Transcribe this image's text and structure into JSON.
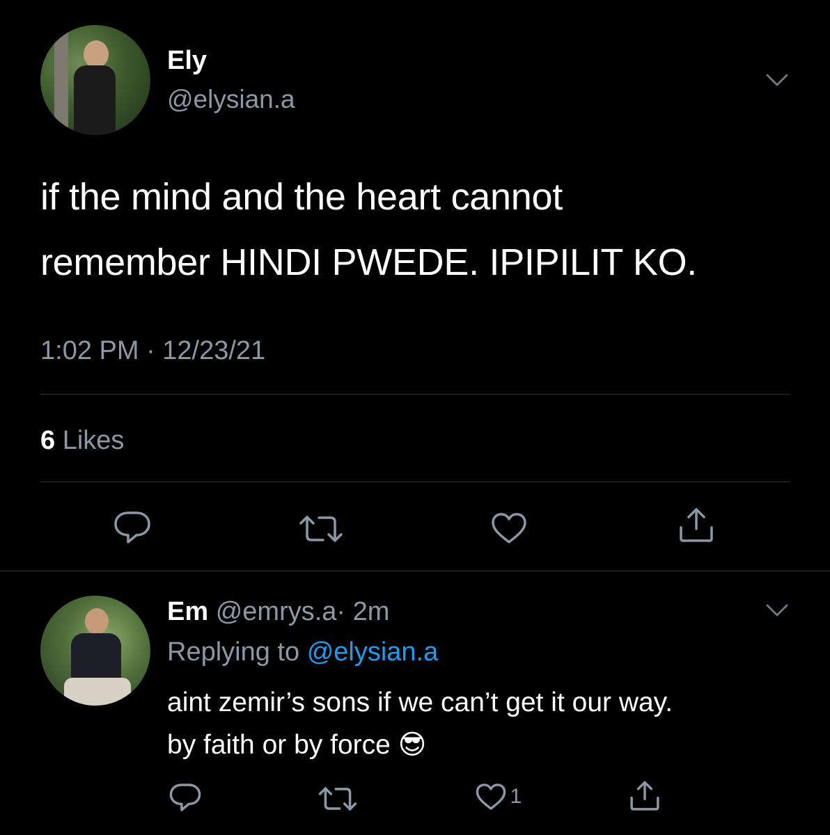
{
  "main_tweet": {
    "author_name": "Ely",
    "author_handle": "@elysian.a",
    "text_line1": "if the mind and the heart cannot",
    "text_line2": "remember HINDI PWEDE. IPIPILIT KO.",
    "timestamp": "1:02 PM · 12/23/21",
    "likes_count": "6",
    "likes_label": "Likes"
  },
  "reply": {
    "author_name": "Em",
    "author_handle": "@emrys.a",
    "age": "· 2m",
    "replying_prefix": "Replying to",
    "replying_to": "@elysian.a",
    "text_line1": "aint zemir’s sons if we can’t get it our way.",
    "text_line2": "by faith or by force",
    "emoji": "😎",
    "like_count": "1"
  },
  "icons": [
    "chevron-down-icon",
    "reply-icon",
    "retweet-icon",
    "heart-icon",
    "share-icon"
  ],
  "colors": {
    "background": "#000000",
    "text": "#ffffff",
    "secondary": "#8b98a5",
    "link": "#1d9bf0",
    "divider": "#2f3336"
  }
}
